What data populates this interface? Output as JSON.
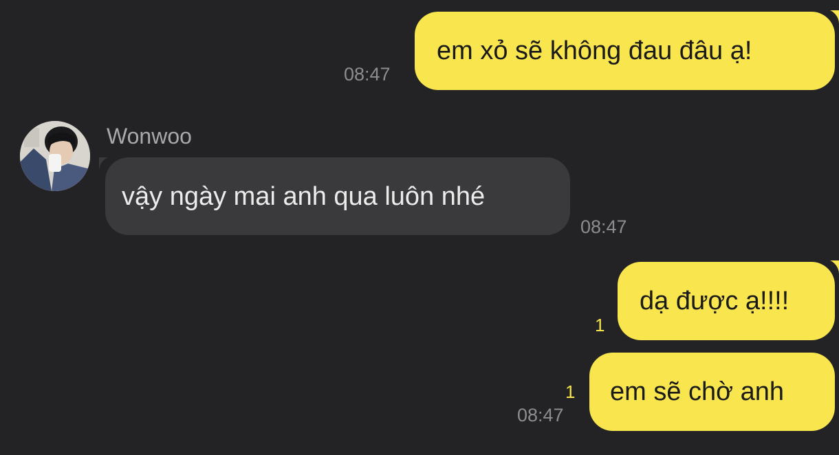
{
  "contact": {
    "name": "Wonwoo"
  },
  "messages": [
    {
      "direction": "outgoing",
      "text": "em xỏ sẽ không đau đâu ạ!",
      "time": "08:47"
    },
    {
      "direction": "incoming",
      "text": "vậy ngày mai anh qua luôn nhé",
      "time": "08:47"
    },
    {
      "direction": "outgoing",
      "text": "dạ được ạ!!!!",
      "unread": "1"
    },
    {
      "direction": "outgoing",
      "text": "em sẽ chờ anh",
      "unread": "1",
      "time": "08:47"
    }
  ],
  "colors": {
    "background": "#232325",
    "outgoing_bubble": "#f9e54e",
    "incoming_bubble": "#3a3a3c",
    "unread_count": "#f9e54e",
    "timestamp": "#8d8d90"
  },
  "icons": {
    "avatar": "profile-photo"
  }
}
